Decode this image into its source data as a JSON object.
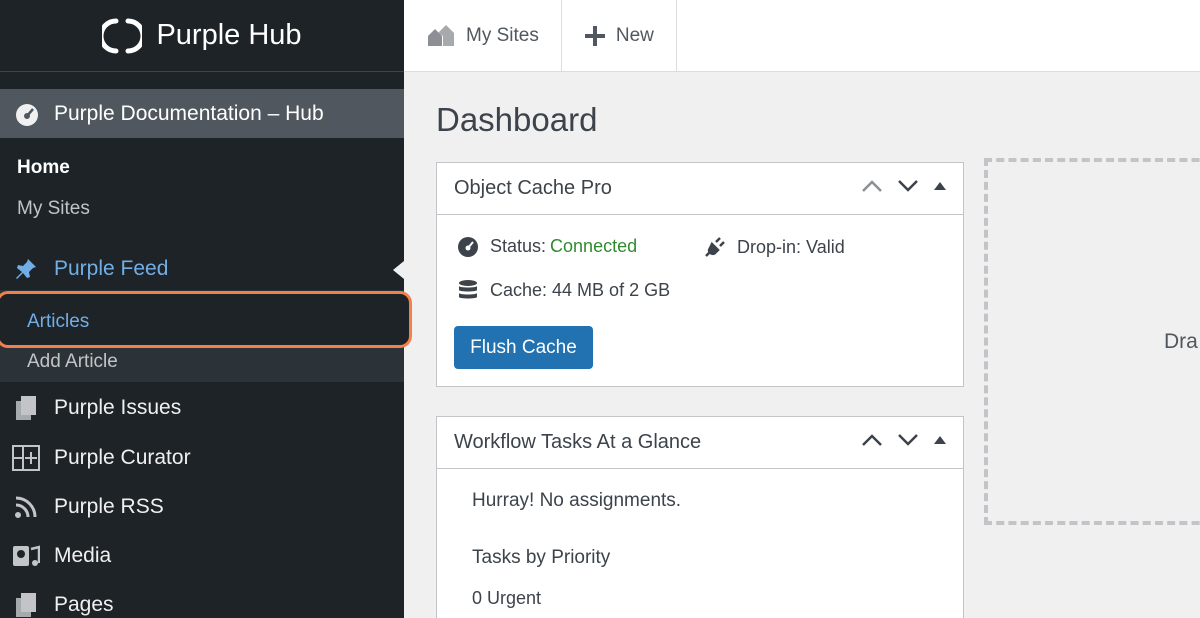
{
  "brand": {
    "name": "Purple Hub"
  },
  "sidebar": {
    "site_name": "Purple Documentation – Hub",
    "home_label": "Home",
    "my_sites_label": "My Sites",
    "feed_label": "Purple Feed",
    "sub_items": [
      "Articles",
      "Add Article"
    ],
    "items": [
      {
        "label": "Purple Issues",
        "icon": "pages-icon"
      },
      {
        "label": "Purple Curator",
        "icon": "grid-plus-icon"
      },
      {
        "label": "Purple RSS",
        "icon": "rss-icon"
      },
      {
        "label": "Media",
        "icon": "media-icon"
      },
      {
        "label": "Pages",
        "icon": "pages-icon"
      }
    ]
  },
  "topbar": {
    "my_sites": "My Sites",
    "new": "New"
  },
  "main": {
    "title": "Dashboard",
    "cache_box": {
      "title": "Object Cache Pro",
      "status_label": "Status:",
      "status_value": "Connected",
      "dropin": "Drop-in: Valid",
      "cache": "Cache: 44 MB of 2 GB",
      "flush_button": "Flush Cache"
    },
    "workflow_box": {
      "title": "Workflow Tasks At a Glance",
      "no_assign": "Hurray! No assignments.",
      "priority_heading": "Tasks by Priority",
      "urgent": "0 Urgent"
    },
    "dropzone_text": "Dra"
  },
  "colors": {
    "accent": "#2271b1",
    "highlight": "#f0814d",
    "sidebar_bg": "#1d2327",
    "link": "#72aee6",
    "status_green": "#2e8b2e"
  }
}
